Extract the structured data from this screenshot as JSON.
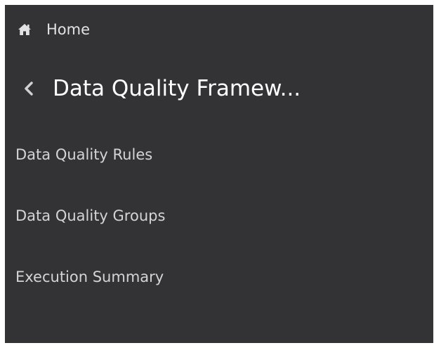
{
  "nav": {
    "home_label": "Home",
    "section_title": "Data Quality Framew...",
    "items": [
      {
        "label": "Data Quality Rules"
      },
      {
        "label": "Data Quality Groups"
      },
      {
        "label": "Execution Summary"
      }
    ]
  },
  "icons": {
    "home": "home-icon",
    "back": "chevron-left-icon"
  },
  "colors": {
    "panel_background": "#333335",
    "title_text": "#ffffff",
    "item_text": "#d4d4d4"
  }
}
